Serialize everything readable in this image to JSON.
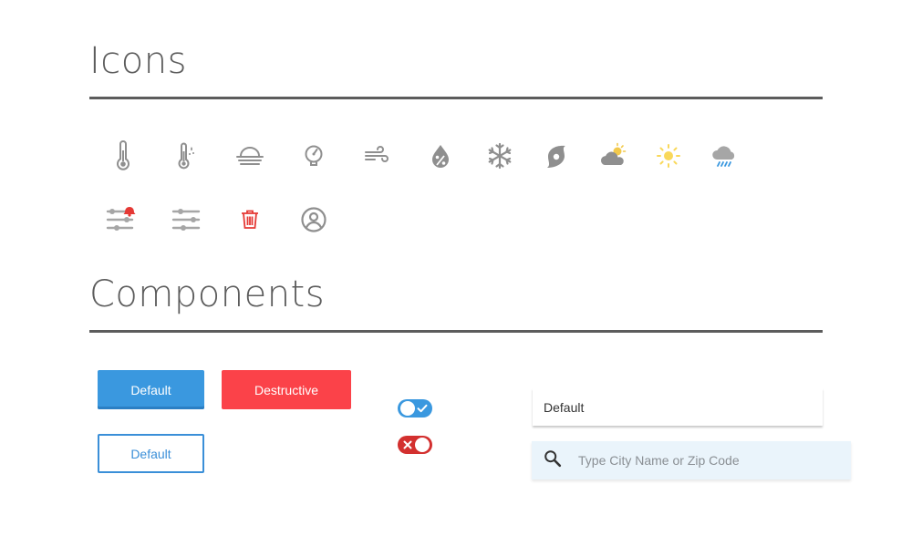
{
  "sections": {
    "icons_title": "Icons",
    "components_title": "Components"
  },
  "icons": [
    {
      "name": "thermometer-icon"
    },
    {
      "name": "thermometer-humidity-icon"
    },
    {
      "name": "fog-icon"
    },
    {
      "name": "barometer-icon"
    },
    {
      "name": "wind-icon"
    },
    {
      "name": "humidity-percent-icon"
    },
    {
      "name": "snowflake-icon"
    },
    {
      "name": "hurricane-icon"
    },
    {
      "name": "partly-cloudy-icon",
      "accent": "#f2c94c"
    },
    {
      "name": "sun-icon",
      "accent": "#f9d85a"
    },
    {
      "name": "rain-cloud-icon",
      "accent": "#3a98df"
    },
    {
      "name": "sliders-alert-icon",
      "accent": "#e53935"
    },
    {
      "name": "sliders-icon"
    },
    {
      "name": "trash-icon",
      "accent": "#e53935"
    },
    {
      "name": "user-circle-icon"
    }
  ],
  "buttons": {
    "primary_label": "Default",
    "destructive_label": "Destructive",
    "outline_label": "Default"
  },
  "toggles": [
    {
      "state": "on",
      "color": "#3a98df"
    },
    {
      "state": "off",
      "color": "#d3302f"
    }
  ],
  "select": {
    "value": "Default"
  },
  "search": {
    "placeholder": "Type City Name or Zip Code",
    "value": ""
  },
  "colors": {
    "primary": "#3a98df",
    "destructive": "#fb4249",
    "icon_gray": "#8f8f8f",
    "heading": "#5c5c5c"
  }
}
